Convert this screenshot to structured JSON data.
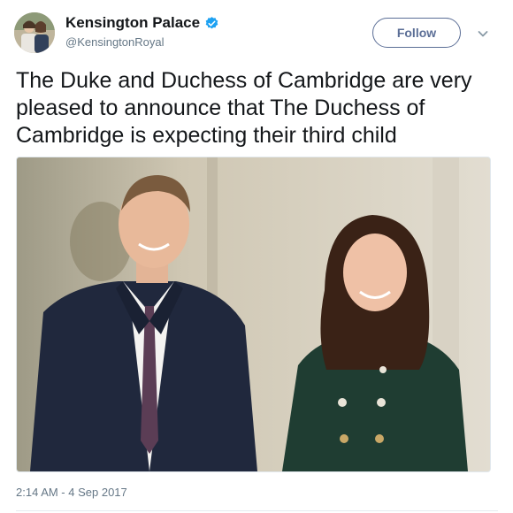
{
  "account": {
    "display_name": "Kensington Palace",
    "handle": "@KensingtonRoyal",
    "verified": true
  },
  "actions": {
    "follow_label": "Follow",
    "more_icon": "chevron-down-icon"
  },
  "tweet": {
    "text": "The Duke and Duchess of Cambridge are very pleased to announce that The Duchess of Cambridge is expecting their third child",
    "media_icon": "photo",
    "timestamp": "2:14 AM - 4 Sep 2017"
  },
  "colors": {
    "text": "#14171a",
    "secondary": "#657786",
    "verified_badge": "#1da1f2",
    "follow_border": "#5b6e96"
  }
}
